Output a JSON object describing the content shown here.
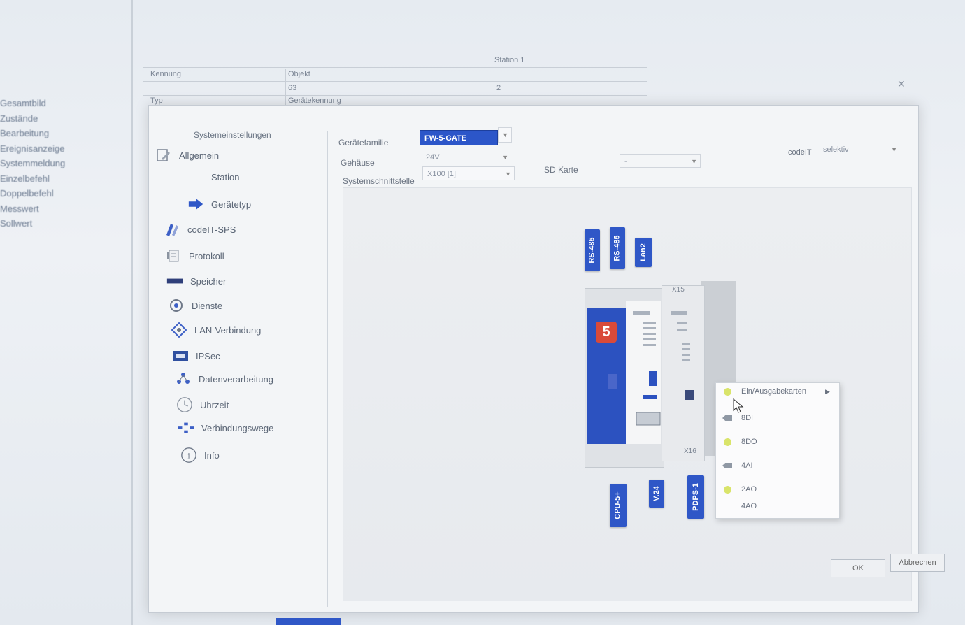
{
  "background_tree": [
    "Gesamtbild",
    "Zustände",
    "Bearbeitung",
    "Ereignisanzeige",
    "Systemmeldung",
    "Einzelbefehl",
    "Doppelbefehl",
    "Messwert",
    "Sollwert"
  ],
  "background_table": {
    "station_header": "Station 1",
    "col1": [
      "Kennung",
      "",
      "Typ"
    ],
    "col2": [
      "Objekt",
      "63",
      "Gerätekennung"
    ],
    "col3_value": "2"
  },
  "nav": {
    "header": "Systemeinstellungen",
    "allgemein": "Allgemein",
    "station": "Station",
    "geraetetyp": "Gerätetyp",
    "codeit": "codeIT-SPS",
    "protokoll": "Protokoll",
    "speicher": "Speicher",
    "dienste": "Dienste",
    "lan": "LAN-Verbindung",
    "ipsec": "IPSec",
    "daten": "Datenverarbeitung",
    "uhrzeit": "Uhrzeit",
    "verbindung": "Verbindungswege",
    "info": "Info"
  },
  "form": {
    "geraetefamilie_label": "Gerätefamilie",
    "geraetefamilie_value": "FW-5-GATE",
    "gehaeuse_label": "Gehäuse",
    "gehaeuse_value": "24V",
    "schnittstelle_label": "Systemschnittstelle",
    "schnittstelle_value": "X100 [1]",
    "sdkarte_label": "SD Karte",
    "sdkarte_value": "-",
    "codeit_label": "codeIT",
    "codeit_value": "selektiv"
  },
  "device": {
    "top_tags": [
      "RS-485",
      "RS-485",
      "Lan2"
    ],
    "bottom_tags": [
      "CPU-5+",
      "V.24",
      "PDPS-1"
    ],
    "x15": "X15",
    "x16": "X16",
    "logo": "5"
  },
  "context_menu": {
    "header": "Ein/Ausgabekarten",
    "items": [
      "8DI",
      "8DO",
      "4AI",
      "2AO",
      "4AO"
    ]
  },
  "buttons": {
    "ok": "OK",
    "cancel": "Abbrechen"
  }
}
